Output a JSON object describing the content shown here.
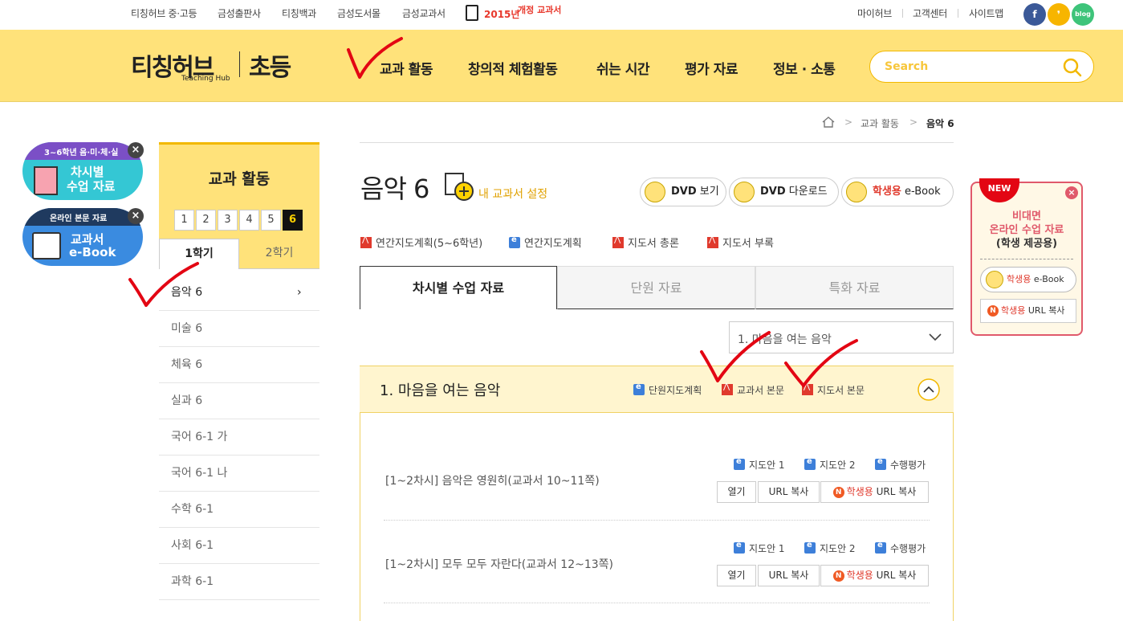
{
  "topbar": {
    "links": [
      "티칭허브 중·고등",
      "금성출판사",
      "티칭백과",
      "금성도서몰",
      "금성교과서"
    ],
    "promo_year": "2015년",
    "promo_text": "개정 교과서",
    "right_links": [
      "마이허브",
      "고객센터",
      "사이트맵"
    ],
    "sns": [
      {
        "name": "facebook",
        "label": "f",
        "color": "#3b5998"
      },
      {
        "name": "kakao",
        "label": "❜",
        "color": "#f7b500"
      },
      {
        "name": "blog",
        "label": "blog",
        "color": "#3ec47a"
      }
    ]
  },
  "header": {
    "logo_main": "티칭허브",
    "logo_sub": "Teaching Hub",
    "logo_section": "초등",
    "nav": [
      "교과 활동",
      "창의적 체험활동",
      "쉬는 시간",
      "평가 자료",
      "정보 · 소통"
    ],
    "search_placeholder": "Search"
  },
  "breadcrumb": [
    "교과 활동",
    "음악 6"
  ],
  "banners": [
    {
      "top": "3~6학년 음·미·체·실",
      "line1": "차시별",
      "line2": "수업 자료"
    },
    {
      "top": "온라인 본문 자료",
      "line1": "교과서",
      "line2": "e-Book"
    }
  ],
  "sidebar": {
    "title": "교과 활동",
    "grades": [
      "1",
      "2",
      "3",
      "4",
      "5",
      "6"
    ],
    "active_grade": "6",
    "semesters": [
      "1학기",
      "2학기"
    ],
    "subjects": [
      "음악 6",
      "미술 6",
      "체육 6",
      "실과 6",
      "국어 6-1 가",
      "국어 6-1 나",
      "수학 6-1",
      "사회 6-1",
      "과학 6-1"
    ]
  },
  "main": {
    "title": "음악 6",
    "my_textbook": "내 교과서 설정",
    "buttons": [
      {
        "bold": "DVD",
        "rest": " 보기"
      },
      {
        "bold": "DVD",
        "rest": " 다운로드"
      },
      {
        "bold": "학생용",
        "rest": " e-Book"
      }
    ],
    "doc_links": [
      {
        "type": "pdf",
        "label": "연간지도계획(5~6학년)"
      },
      {
        "type": "hwp",
        "label": "연간지도계획"
      },
      {
        "type": "pdf",
        "label": "지도서 총론"
      },
      {
        "type": "pdf",
        "label": "지도서 부록"
      }
    ],
    "tabs": [
      "차시별 수업 자료",
      "단원 자료",
      "특화 자료"
    ],
    "unit_select": "1. 마음을 여는 음악",
    "unit": {
      "title": "1. 마음을 여는 음악",
      "links": [
        {
          "type": "hwp",
          "label": "단원지도계획"
        },
        {
          "type": "pdf",
          "label": "교과서 본문"
        },
        {
          "type": "pdf",
          "label": "지도서 본문"
        }
      ]
    },
    "lessons": [
      {
        "title": "[1~2차시] 음악은 영원히(교과서 10~11쪽)",
        "resources": [
          "지도안 1",
          "지도안 2",
          "수행평가"
        ],
        "open": "열기",
        "url": "URL 복사",
        "student_bold": "학생용",
        "student_rest": " URL 복사"
      },
      {
        "title": "[1~2차시] 모두 모두 자란다(교과서 12~13쪽)",
        "resources": [
          "지도안 1",
          "지도안 2",
          "수행평가"
        ],
        "open": "열기",
        "url": "URL 복사",
        "student_bold": "학생용",
        "student_rest": " URL 복사"
      }
    ]
  },
  "popup": {
    "badge": "NEW",
    "line1": "비대면",
    "line2": "온라인 수업 자료",
    "line3": "(학생 제공용)",
    "btn1_bold": "학생용",
    "btn1_rest": " e-Book",
    "btn2_bold": "학생용",
    "btn2_rest": " URL 복사"
  },
  "colors": {
    "accent": "#ffe27a",
    "brand": "#f2b800",
    "pdf": "#e03a2d",
    "hwp": "#3d7fd9",
    "annotation": "#e30613"
  }
}
